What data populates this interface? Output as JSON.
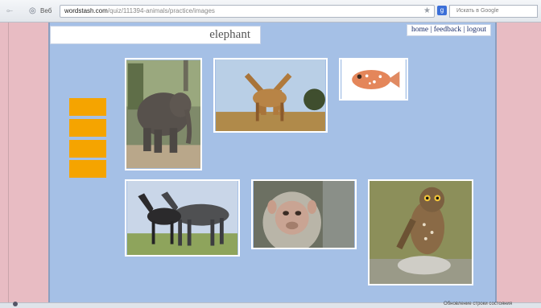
{
  "browser": {
    "tab_label": "Вeб",
    "url_host": "wordstash.com",
    "url_path": "/quiz/111394-animals/practice/images",
    "search_placeholder": "Искать в Google",
    "google_glyph": "g",
    "status_text": "Обновление строки состояния"
  },
  "quiz": {
    "word": "elephant",
    "nav": {
      "home": "home",
      "sep1": " | ",
      "feedback": "feedback",
      "sep2": " | ",
      "logout": "logout"
    },
    "answer_slots": 4,
    "images": [
      {
        "animal": "elephant",
        "icon": "elephant-photo"
      },
      {
        "animal": "giraffes",
        "icon": "giraffe-photo"
      },
      {
        "animal": "fish",
        "icon": "fish-photo"
      },
      {
        "animal": "horses",
        "icon": "horse-photo"
      },
      {
        "animal": "monkey",
        "icon": "monkey-photo"
      },
      {
        "animal": "owl",
        "icon": "owl-photo"
      }
    ]
  },
  "colors": {
    "page_background": "#a5c0e6",
    "side_background": "#e8bcc3",
    "answer_slot": "#f5a400",
    "nav_link": "#1a2d6b"
  }
}
